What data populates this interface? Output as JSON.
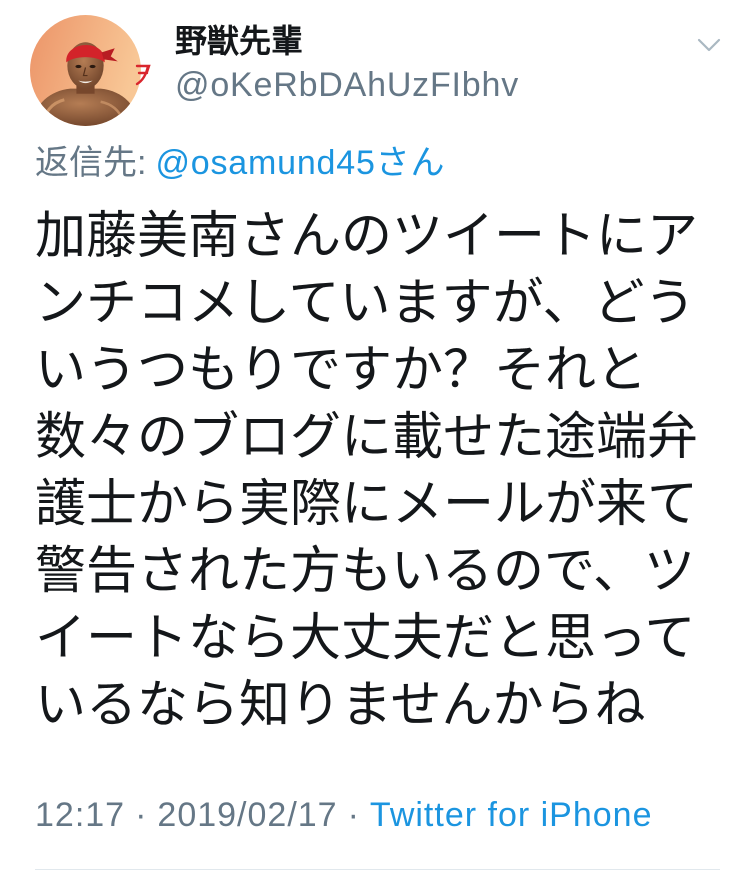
{
  "tweet": {
    "author": {
      "display_name": "野獣先輩",
      "handle": "@oKeRbDAhUzFIbhv",
      "avatar_icon": "profile-photo"
    },
    "menu_icon": "chevron-down-icon",
    "reply": {
      "label": "返信先:",
      "to": "@osamund45さん"
    },
    "text_lines": [
      "加藤美南さんのツイートにア",
      "ンチコメしていますが、どう",
      "いうつもりですか？それと",
      "数々のブログに載せた途端弁",
      "護士から実際にメールが来て",
      "警告された方もいるので、ツ",
      "イートなら大丈夫だと思って",
      "いるなら知りませんからね"
    ],
    "meta": {
      "time": "12:17",
      "separator": "·",
      "date": "2019/02/17",
      "source": "Twitter for iPhone"
    }
  },
  "colors": {
    "text": "#14171a",
    "secondary": "#657786",
    "link": "#1b95e0",
    "divider": "#e1e8ed",
    "icon": "#aab8c2"
  }
}
